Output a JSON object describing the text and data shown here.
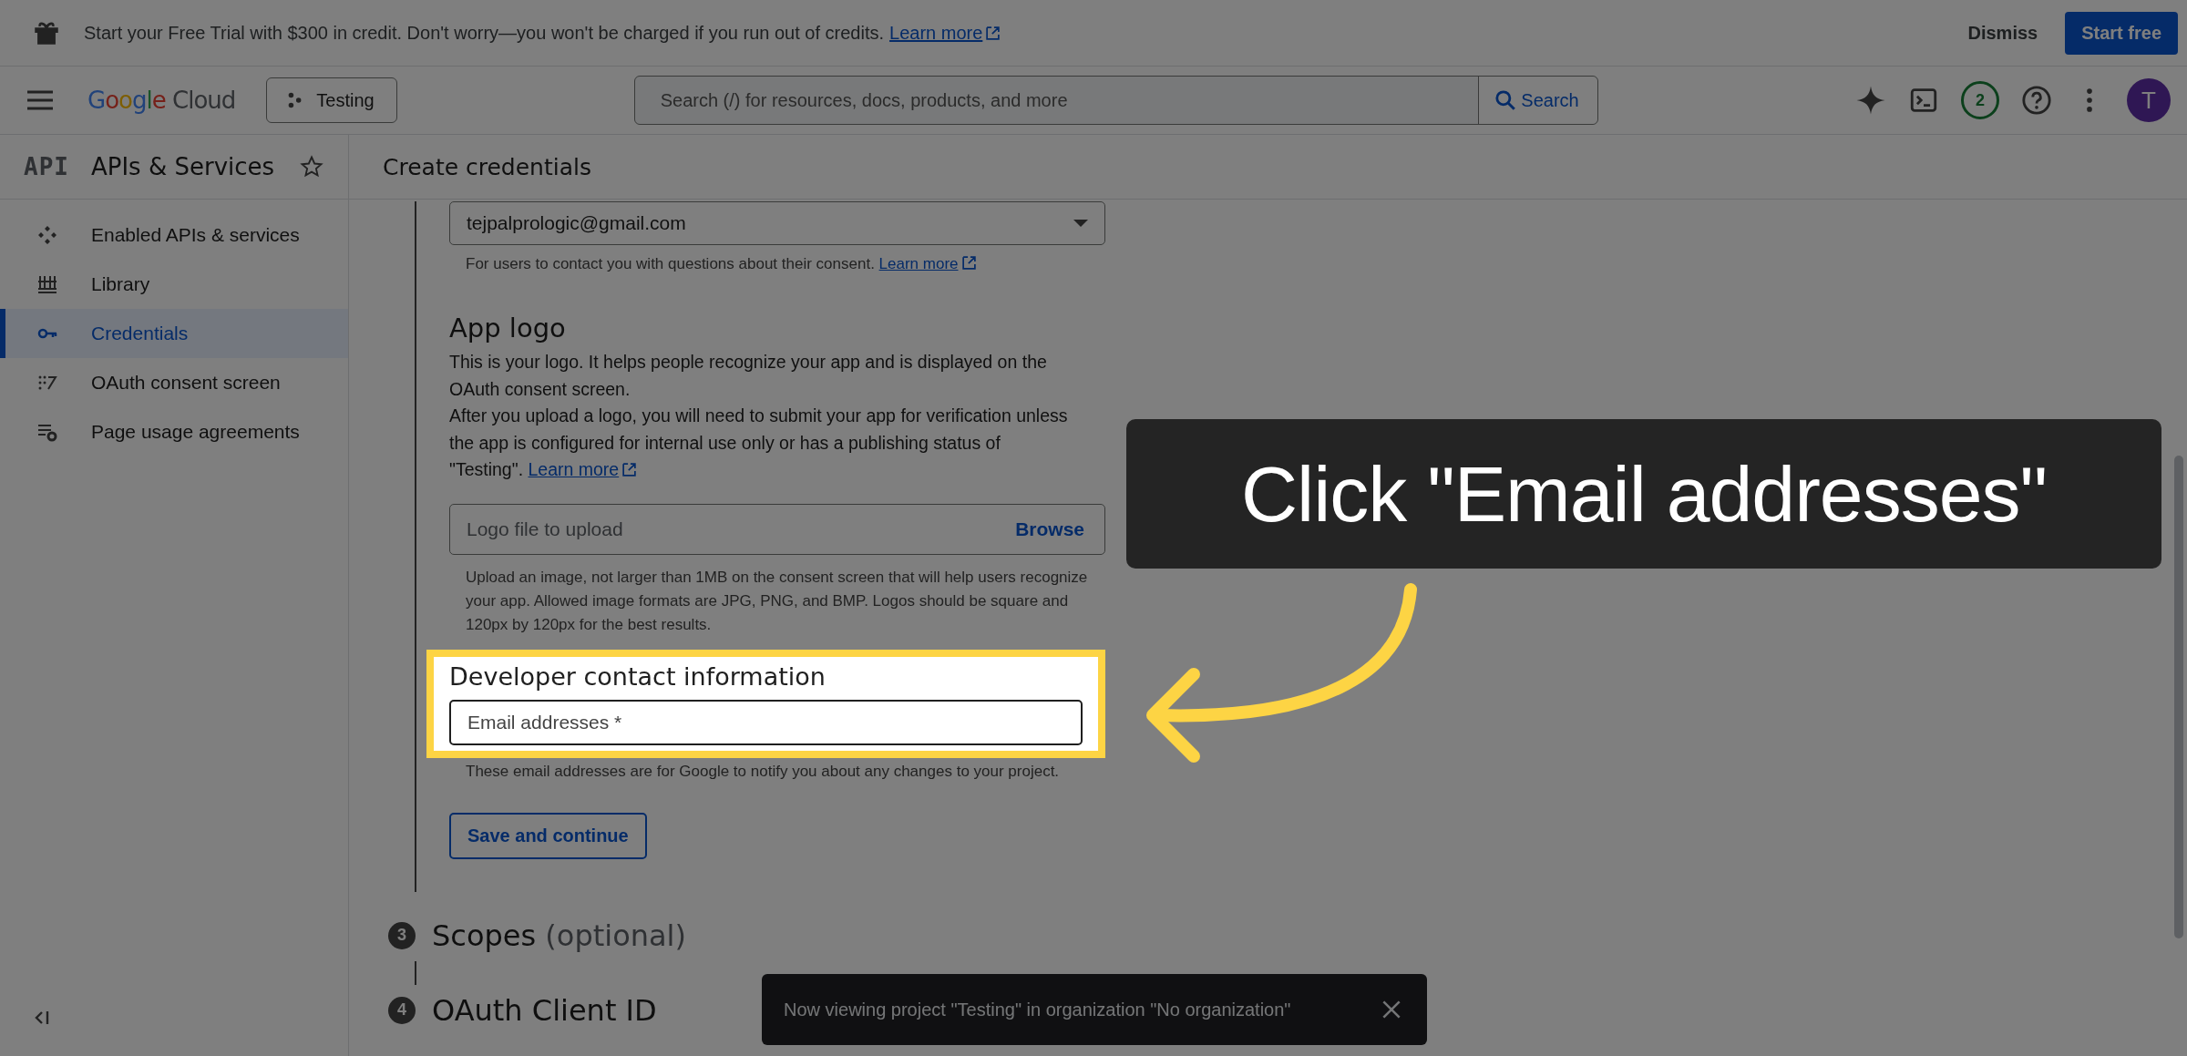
{
  "banner": {
    "text": "Start your Free Trial with $300 in credit. Don't worry—you won't be charged if you run out of credits.",
    "link": "Learn more",
    "buttons": [
      {
        "label": "Dismiss",
        "kind": "text"
      },
      {
        "label": "Start free",
        "kind": "filled"
      }
    ]
  },
  "header": {
    "logo": "Google Cloud",
    "project": "Testing",
    "search": {
      "placeholder": "Search (/) for resources, docs, products, and more",
      "button": "Search"
    },
    "notifications": "2",
    "avatar": "T"
  },
  "sidebar": {
    "badge": "API",
    "title": "APIs & Services",
    "items": [
      {
        "label": "Enabled APIs & services",
        "selected": false
      },
      {
        "label": "Library",
        "selected": false
      },
      {
        "label": "Credentials",
        "selected": true
      },
      {
        "label": "OAuth consent screen",
        "selected": false
      },
      {
        "label": "Page usage agreements",
        "selected": false
      }
    ]
  },
  "main": {
    "title": "Create credentials",
    "support_email": {
      "value": "tejpalprologic@gmail.com",
      "helper": "For users to contact you with questions about their consent.",
      "link": "Learn more"
    },
    "app_logo": {
      "heading": "App logo",
      "paragraphs": [
        "This is your logo. It helps people recognize your app and is displayed on the OAuth consent screen.",
        "After you upload a logo, you will need to submit your app for verification unless the app is configured for internal use only or has a publishing status of \"Testing\"."
      ],
      "link": "Learn more",
      "upload": {
        "placeholder": "Logo file to upload",
        "button": "Browse"
      },
      "helper": "Upload an image, not larger than 1MB on the consent screen that will help users recognize your app. Allowed image formats are JPG, PNG, and BMP. Logos should be square and 120px by 120px for the best results."
    },
    "developer": {
      "heading": "Developer contact information",
      "field": {
        "placeholder": "Email addresses *"
      },
      "helper": "These email addresses are for Google to notify you about any changes to your project.",
      "highlighted": true
    },
    "save_button": "Save and continue",
    "steps": [
      {
        "number": "3",
        "title": "Scopes",
        "suffix": "(optional)"
      },
      {
        "number": "4",
        "title": "OAuth Client ID"
      }
    ]
  },
  "toast": {
    "text": "Now viewing project \"Testing\" in organization \"No organization\""
  },
  "callout": {
    "text": "Click \"Email addresses\""
  }
}
